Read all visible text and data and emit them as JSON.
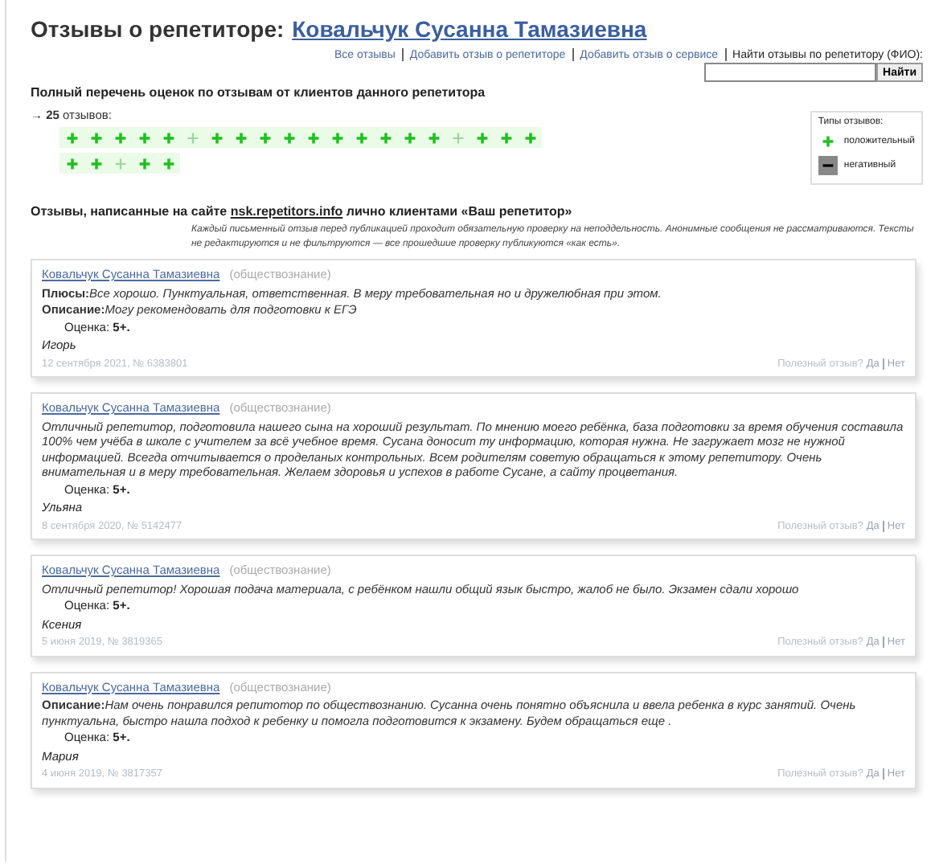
{
  "title": {
    "prefix": "Отзывы о репетиторе:",
    "tutor": "Ковальчук Сусанна Тамазиевна"
  },
  "nav_links": [
    "Все отзывы",
    "Добавить отзыв о репетиторе",
    "Добавить отзыв о сервисе"
  ],
  "search": {
    "label": "Найти отзывы по репетитору (ФИО):",
    "button": "Найти"
  },
  "ratings": {
    "heading": "Полный перечень оценок по отзывам от клиентов данного репетитора",
    "arrow": "→",
    "count": "25",
    "count_suffix": "отзывов:",
    "marks": [
      {
        "kind": "positive",
        "dim": false
      },
      {
        "kind": "positive",
        "dim": false
      },
      {
        "kind": "positive",
        "dim": false
      },
      {
        "kind": "positive",
        "dim": false
      },
      {
        "kind": "positive",
        "dim": false
      },
      {
        "kind": "positive",
        "dim": true
      },
      {
        "kind": "positive",
        "dim": false
      },
      {
        "kind": "positive",
        "dim": false
      },
      {
        "kind": "positive",
        "dim": false
      },
      {
        "kind": "positive",
        "dim": false
      },
      {
        "kind": "positive",
        "dim": false
      },
      {
        "kind": "positive",
        "dim": false
      },
      {
        "kind": "positive",
        "dim": false
      },
      {
        "kind": "positive",
        "dim": false
      },
      {
        "kind": "positive",
        "dim": false
      },
      {
        "kind": "positive",
        "dim": false
      },
      {
        "kind": "positive",
        "dim": true
      },
      {
        "kind": "positive",
        "dim": false
      },
      {
        "kind": "positive",
        "dim": false
      },
      {
        "kind": "positive",
        "dim": false
      },
      {
        "kind": "positive",
        "dim": false
      },
      {
        "kind": "positive",
        "dim": false
      },
      {
        "kind": "positive",
        "dim": true
      },
      {
        "kind": "positive",
        "dim": false
      },
      {
        "kind": "positive",
        "dim": false
      }
    ],
    "legend": {
      "title": "Типы отзывов:",
      "items": [
        {
          "kind": "positive",
          "label": "положительный"
        },
        {
          "kind": "negative",
          "label": "негативный"
        }
      ]
    }
  },
  "reviews_heading": {
    "before": "Отзывы, написанные на сайте",
    "site": "nsk.repetitors.info",
    "after": "лично клиентами «Ваш репетитор»"
  },
  "notice": "Каждый письменный отзыв перед публикацией проходит обязательную проверку на неподдельность. Анонимные сообщения не рассматриваются. Тексты не редактируются и не фильтруются — все прошедшие проверку публикуются «как есть».",
  "reviews": [
    {
      "tutor": "Ковальчук Сусанна Тамазиевна",
      "subject": "(обществознание)",
      "entries": [
        {
          "label": "Плюсы:",
          "text": "Все хорошо. Пунктуальная, ответственная. В меру требовательная но и дружелюбная при этом."
        },
        {
          "label": "Описание:",
          "text": "Могу рекомендовать для подготовки к ЕГЭ"
        }
      ],
      "grade_label": "Оценка:",
      "grade": "5+.",
      "author": "Игорь",
      "date": "12 сентября 2021, № 6383801",
      "helpful": "Полезный отзыв?",
      "yes": "Да",
      "no": "Нет"
    },
    {
      "tutor": "Ковальчук Сусанна Тамазиевна",
      "subject": "(обществознание)",
      "entries": [
        {
          "text": "Отличный репетитор, подготовила нашего сына на хороший результат. По мнению моего ребёнка, база подготовки за время обучения составила 100% чем учёба в школе с учителем за всё учебное время. Сусана доносит ту информацию, которая нужна. Не загружает мозг не нужной информацией. Всегда отчитывается о проделаных контрольных. Всем родителям советую обращаться к этому репетитору. Очень внимательная и в меру требовательная. Желаем здоровья и успехов в работе Сусане, а сайту процветания."
        }
      ],
      "grade_label": "Оценка:",
      "grade": "5+.",
      "author": "Ульяна",
      "date": "8 сентября 2020, № 5142477",
      "helpful": "Полезный отзыв?",
      "yes": "Да",
      "no": "Нет"
    },
    {
      "tutor": "Ковальчук Сусанна Тамазиевна",
      "subject": "(обществознание)",
      "entries": [
        {
          "text": "Отличный репетитор! Хорошая подача материала, с ребёнком нашли общий язык быстро, жалоб не было. Экзамен сдали хорошо"
        }
      ],
      "grade_label": "Оценка:",
      "grade": "5+.",
      "author": "Ксения",
      "date": "5 июня 2019, № 3819365",
      "helpful": "Полезный отзыв?",
      "yes": "Да",
      "no": "Нет"
    },
    {
      "tutor": "Ковальчук Сусанна Тамазиевна",
      "subject": "(обществознание)",
      "entries": [
        {
          "label": "Описание:",
          "text": "Нам очень понравился репитотор по обществознанию. Сусанна очень понятно объяснила и ввела ребенка в курс занятий. Очень пунктуальна, быстро нашла подход к ребенку и помогла подготовится к экзамену. Будем обращаться еще ."
        }
      ],
      "grade_label": "Оценка:",
      "grade": "5+.",
      "author": "Мария",
      "date": "4 июня 2019, № 3817357",
      "helpful": "Полезный отзыв?",
      "yes": "Да",
      "no": "Нет"
    }
  ]
}
